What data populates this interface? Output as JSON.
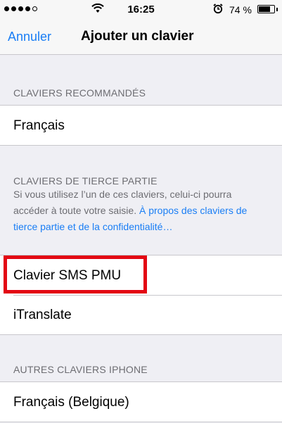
{
  "status_bar": {
    "time": "16:25",
    "battery_percent_label": "74 %",
    "battery_level": 0.74,
    "signal_bars_filled": 4,
    "signal_bars_total": 5
  },
  "nav": {
    "cancel_label": "Annuler",
    "title": "Ajouter un clavier"
  },
  "sections": {
    "recommended": {
      "header": "CLAVIERS RECOMMANDÉS",
      "items": [
        "Français"
      ]
    },
    "third_party": {
      "header": "CLAVIERS DE TIERCE PARTIE",
      "footer_text": "Si vous utilisez l’un de ces claviers, celui-ci pourra accéder à toute votre saisie.",
      "footer_link": "À propos des claviers de tierce partie et de la confidentialité…",
      "items": [
        "Clavier SMS PMU",
        "iTranslate"
      ]
    },
    "other": {
      "header": "AUTRES CLAVIERS IPHONE",
      "items": [
        "Français (Belgique)"
      ]
    }
  },
  "annotation": {
    "highlight_color": "#e30613"
  },
  "colors": {
    "accent": "#1a7ef5",
    "background": "#efeff4"
  }
}
